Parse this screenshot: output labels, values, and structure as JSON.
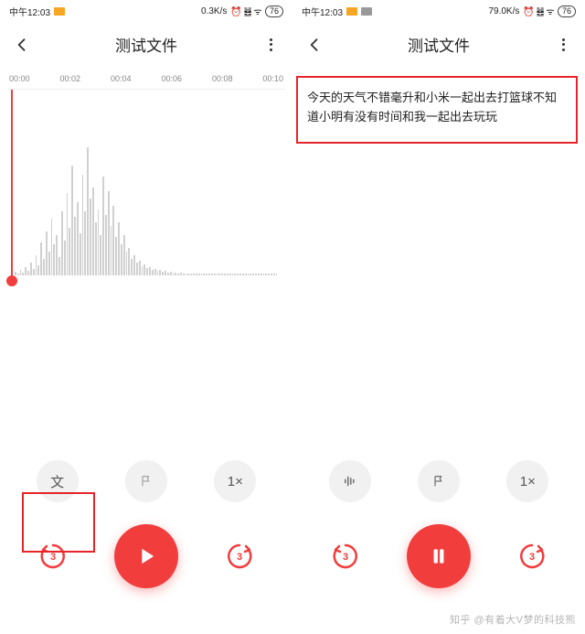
{
  "left": {
    "status": {
      "time": "中午12:03",
      "rate": "0.3K/s",
      "sys": "⏰ ䷾ ᯤ",
      "battery": "76"
    },
    "title": "测试文件",
    "ticks": [
      "00:00",
      "00:02",
      "00:04",
      "00:06",
      "00:08",
      "00:10"
    ],
    "row1": {
      "b1": "文",
      "b2_icon": "flag",
      "b3": "1×"
    },
    "row2": {
      "skip": "3"
    }
  },
  "right": {
    "status": {
      "time": "中午12:03",
      "rate": "79.0K/s",
      "sys": "⏰ ䷾ ᯤ",
      "battery": "76"
    },
    "title": "测试文件",
    "transcription": "今天的天气不错毫升和小米一起出去打篮球不知道小明有没有时间和我一起出去玩玩",
    "row1": {
      "b1_icon": "bars",
      "b2_icon": "flag",
      "b3": "1×"
    },
    "row2": {
      "skip": "3"
    }
  },
  "watermark": "知乎 @有着大V梦的科技熊",
  "wave_heights": [
    4,
    2,
    6,
    3,
    9,
    5,
    14,
    7,
    22,
    11,
    36,
    18,
    48,
    26,
    62,
    34,
    44,
    20,
    70,
    38,
    90,
    52,
    120,
    64,
    80,
    46,
    110,
    70,
    140,
    84,
    96,
    58,
    72,
    44,
    108,
    66,
    92,
    54,
    76,
    42,
    58,
    34,
    44,
    26,
    30,
    18,
    22,
    14,
    16,
    10,
    12,
    8,
    9,
    6,
    7,
    5,
    6,
    4,
    5,
    3,
    4,
    3,
    3,
    2,
    3,
    2,
    2,
    2,
    2,
    2,
    2,
    2,
    2,
    2,
    2,
    2,
    2,
    2,
    2,
    2,
    2,
    2,
    2,
    2,
    2,
    2,
    2,
    2,
    2,
    2,
    2,
    2,
    2,
    2,
    2,
    2,
    2,
    2,
    2,
    2,
    2,
    2
  ]
}
